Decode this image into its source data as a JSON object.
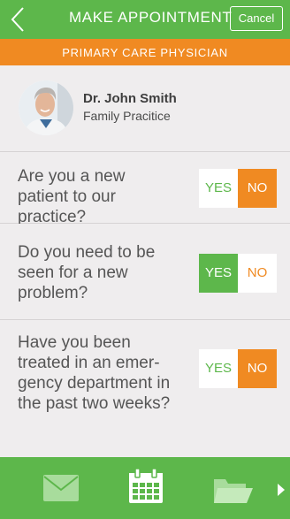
{
  "header": {
    "title": "MAKE APPOINTMENT",
    "cancel_label": "Cancel",
    "subtitle": "PRIMARY CARE PHYSICIAN"
  },
  "doctor": {
    "name": "Dr. John Smith",
    "specialty": "Family Pracitice"
  },
  "questions": [
    {
      "text": "Are you a new patient to our practice?",
      "yes_label": "YES",
      "no_label": "NO",
      "selected": "NO"
    },
    {
      "text": "Do you need to be seen for a new problem?",
      "yes_label": "YES",
      "no_label": "NO",
      "selected": "YES"
    },
    {
      "text": "Have you been treated in an emer-gency department in the past two weeks?",
      "yes_label": "YES",
      "no_label": "NO",
      "selected": "NO"
    }
  ],
  "bottom_tabs": [
    {
      "icon": "envelope-icon"
    },
    {
      "icon": "calendar-icon"
    },
    {
      "icon": "folder-icon"
    },
    {
      "icon": "chevron-right-icon"
    }
  ],
  "colors": {
    "green": "#5db74b",
    "orange": "#f08a22",
    "background": "#efedee"
  }
}
